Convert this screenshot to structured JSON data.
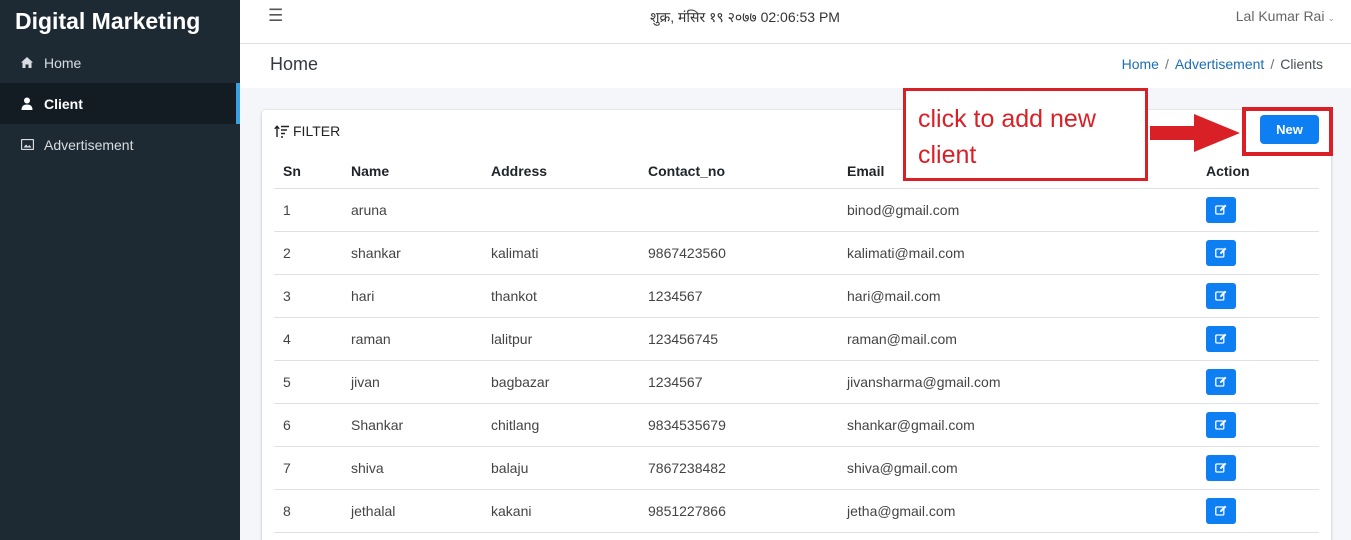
{
  "app": {
    "brand": "Digital Marketing"
  },
  "sidebar": {
    "items": [
      {
        "label": "Home",
        "icon": "home-icon",
        "active": false
      },
      {
        "label": "Client",
        "icon": "user-icon",
        "active": true
      },
      {
        "label": "Advertisement",
        "icon": "image-icon",
        "active": false
      }
    ]
  },
  "topbar": {
    "datetime": "शुक्र, मंसिर १९ २०७७ 02:06:53 PM",
    "user": "Lal Kumar Rai"
  },
  "header": {
    "title": "Home",
    "breadcrumb": {
      "home": "Home",
      "advertisement": "Advertisement",
      "current": "Clients"
    }
  },
  "card": {
    "filter_label": "FILTER",
    "new_label": "New",
    "columns": [
      "Sn",
      "Name",
      "Address",
      "Contact_no",
      "Email",
      "Action"
    ],
    "rows": [
      {
        "sn": "1",
        "name": "aruna",
        "address": "",
        "contact": "",
        "email": "binod@gmail.com"
      },
      {
        "sn": "2",
        "name": "shankar",
        "address": "kalimati",
        "contact": "9867423560",
        "email": "kalimati@mail.com"
      },
      {
        "sn": "3",
        "name": "hari",
        "address": "thankot",
        "contact": "1234567",
        "email": "hari@mail.com"
      },
      {
        "sn": "4",
        "name": "raman",
        "address": "lalitpur",
        "contact": "123456745",
        "email": "raman@mail.com"
      },
      {
        "sn": "5",
        "name": "jivan",
        "address": "bagbazar",
        "contact": "1234567",
        "email": "jivansharma@gmail.com"
      },
      {
        "sn": "6",
        "name": "Shankar",
        "address": "chitlang",
        "contact": "9834535679",
        "email": "shankar@gmail.com"
      },
      {
        "sn": "7",
        "name": "shiva",
        "address": "balaju",
        "contact": "7867238482",
        "email": "shiva@gmail.com"
      },
      {
        "sn": "8",
        "name": "jethalal",
        "address": "kakani",
        "contact": "9851227866",
        "email": "jetha@gmail.com"
      }
    ]
  },
  "annotation": {
    "text": "click to add new client",
    "color": "#d92027"
  },
  "colors": {
    "sidebar": "#1e2a33",
    "primary": "#0d7ff2",
    "link": "#1d6fb3"
  }
}
